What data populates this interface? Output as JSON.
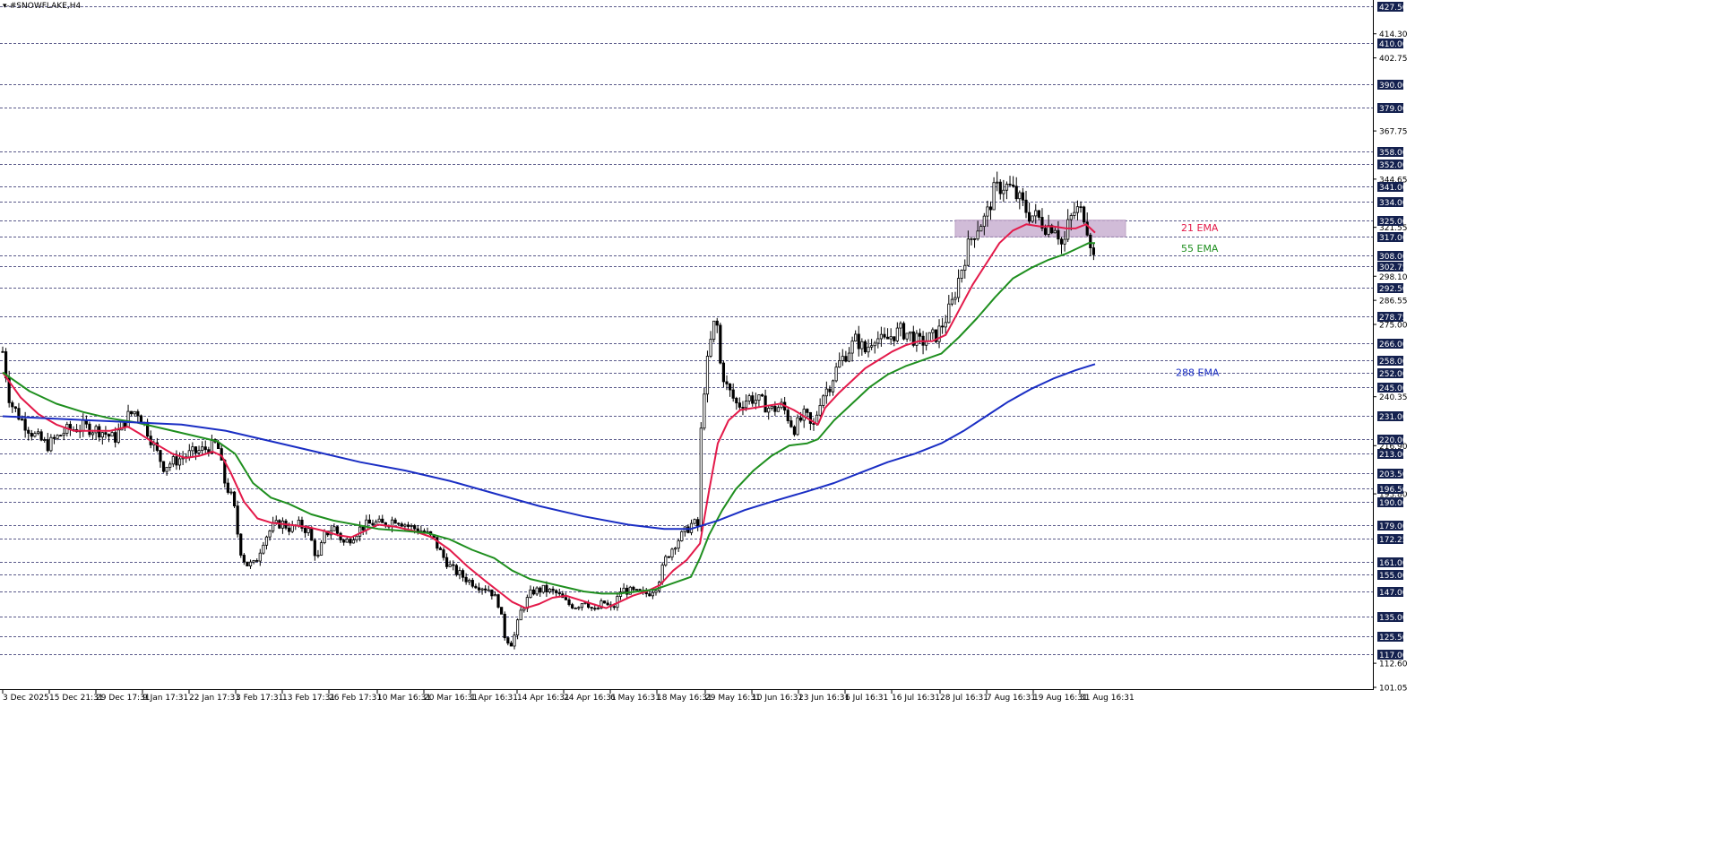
{
  "title": "▾-#SNOWFLAKE,H4",
  "colors": {
    "ema21": "#e31a4a",
    "ema55": "#1f8f1f",
    "ema288": "#1a2ec4",
    "zone": "#cdb5d4",
    "tag": "#14214f",
    "grid": "#5a5a8a"
  },
  "chart_data": {
    "type": "candlestick",
    "symbol": "#SNOWFLAKE",
    "timeframe": "H4",
    "ylim": [
      101.05,
      427.5
    ],
    "y_ticks": [
      "414.30",
      "402.75",
      "367.75",
      "344.65",
      "321.55",
      "298.10",
      "286.55",
      "275.00",
      "240.35",
      "216.90",
      "193.80",
      "112.60",
      "101.05"
    ],
    "x_ticks": [
      "3 Dec 2025",
      "15 Dec 21:31",
      "29 Dec 17:31",
      "9 Jan 17:31",
      "22 Jan 17:31",
      "3 Feb 17:31",
      "13 Feb 17:31",
      "26 Feb 17:31",
      "10 Mar 16:31",
      "20 Mar 16:31",
      "1 Apr 16:31",
      "14 Apr 16:31",
      "24 Apr 16:31",
      "6 May 16:31",
      "18 May 16:31",
      "29 May 16:31",
      "10 Jun 16:31",
      "23 Jun 16:31",
      "6 Jul 16:31",
      "16 Jul 16:31",
      "28 Jul 16:31",
      "7 Aug 16:31",
      "19 Aug 16:31",
      "31 Aug 16:31"
    ],
    "levels": [
      "427.50",
      "410.00",
      "390.00",
      "379.00",
      "358.00",
      "352.00",
      "341.00",
      "334.00",
      "325.00",
      "317.00",
      "308.00",
      "302.75",
      "292.50",
      "278.75",
      "266.00",
      "258.00",
      "252.00",
      "245.00",
      "231.00",
      "220.00",
      "213.00",
      "203.50",
      "196.50",
      "190.00",
      "179.00",
      "172.25",
      "161.00",
      "155.00",
      "147.00",
      "135.00",
      "125.50",
      "117.00"
    ],
    "zone": {
      "low": 317.0,
      "high": 325.0
    },
    "series": [
      {
        "name": "21 EMA",
        "key": "ema21",
        "points": [
          [
            0,
            252
          ],
          [
            20,
            240
          ],
          [
            40,
            232
          ],
          [
            60,
            227
          ],
          [
            80,
            224
          ],
          [
            100,
            224
          ],
          [
            120,
            224
          ],
          [
            140,
            226
          ],
          [
            152,
            223
          ],
          [
            170,
            218
          ],
          [
            190,
            213
          ],
          [
            205,
            211
          ],
          [
            220,
            212
          ],
          [
            235,
            214
          ],
          [
            245,
            212
          ],
          [
            255,
            204
          ],
          [
            270,
            190
          ],
          [
            285,
            182
          ],
          [
            300,
            180
          ],
          [
            320,
            179
          ],
          [
            340,
            178
          ],
          [
            360,
            176
          ],
          [
            375,
            174
          ],
          [
            390,
            173
          ],
          [
            405,
            176
          ],
          [
            420,
            179
          ],
          [
            440,
            178
          ],
          [
            460,
            176
          ],
          [
            480,
            173
          ],
          [
            500,
            167
          ],
          [
            520,
            159
          ],
          [
            540,
            152
          ],
          [
            555,
            147
          ],
          [
            570,
            142
          ],
          [
            585,
            139
          ],
          [
            600,
            141
          ],
          [
            615,
            144
          ],
          [
            630,
            145
          ],
          [
            645,
            143
          ],
          [
            660,
            141
          ],
          [
            675,
            139
          ],
          [
            690,
            142
          ],
          [
            705,
            145
          ],
          [
            720,
            147
          ],
          [
            735,
            150
          ],
          [
            750,
            157
          ],
          [
            765,
            162
          ],
          [
            780,
            170
          ],
          [
            790,
            195
          ],
          [
            800,
            218
          ],
          [
            812,
            229
          ],
          [
            825,
            234
          ],
          [
            840,
            235
          ],
          [
            855,
            236
          ],
          [
            870,
            237
          ],
          [
            885,
            234
          ],
          [
            900,
            230
          ],
          [
            912,
            227
          ],
          [
            920,
            235
          ],
          [
            935,
            242
          ],
          [
            950,
            248
          ],
          [
            965,
            254
          ],
          [
            980,
            258
          ],
          [
            995,
            262
          ],
          [
            1010,
            265
          ],
          [
            1025,
            267
          ],
          [
            1040,
            267
          ],
          [
            1055,
            270
          ],
          [
            1070,
            282
          ],
          [
            1085,
            294
          ],
          [
            1100,
            304
          ],
          [
            1115,
            314
          ],
          [
            1130,
            320
          ],
          [
            1145,
            323
          ],
          [
            1160,
            322
          ],
          [
            1175,
            322
          ],
          [
            1190,
            321
          ],
          [
            1200,
            321
          ],
          [
            1212,
            323
          ],
          [
            1222,
            319
          ]
        ]
      },
      {
        "name": "55 EMA",
        "key": "ema55",
        "points": [
          [
            0,
            252
          ],
          [
            30,
            243
          ],
          [
            60,
            237
          ],
          [
            90,
            233
          ],
          [
            120,
            230
          ],
          [
            150,
            228
          ],
          [
            180,
            225
          ],
          [
            210,
            222
          ],
          [
            240,
            219
          ],
          [
            260,
            213
          ],
          [
            280,
            199
          ],
          [
            300,
            192
          ],
          [
            320,
            189
          ],
          [
            345,
            184
          ],
          [
            370,
            181
          ],
          [
            395,
            179
          ],
          [
            420,
            177
          ],
          [
            450,
            176
          ],
          [
            475,
            175
          ],
          [
            500,
            172
          ],
          [
            525,
            167
          ],
          [
            550,
            163
          ],
          [
            570,
            157
          ],
          [
            590,
            153
          ],
          [
            610,
            151
          ],
          [
            630,
            149
          ],
          [
            650,
            147
          ],
          [
            670,
            146
          ],
          [
            690,
            146
          ],
          [
            710,
            147
          ],
          [
            730,
            148
          ],
          [
            750,
            151
          ],
          [
            770,
            154
          ],
          [
            780,
            163
          ],
          [
            790,
            174
          ],
          [
            805,
            186
          ],
          [
            820,
            196
          ],
          [
            840,
            205
          ],
          [
            860,
            212
          ],
          [
            880,
            217
          ],
          [
            900,
            218
          ],
          [
            912,
            220
          ],
          [
            930,
            229
          ],
          [
            950,
            237
          ],
          [
            970,
            245
          ],
          [
            990,
            251
          ],
          [
            1010,
            255
          ],
          [
            1030,
            258
          ],
          [
            1050,
            261
          ],
          [
            1070,
            269
          ],
          [
            1090,
            278
          ],
          [
            1110,
            288
          ],
          [
            1130,
            297
          ],
          [
            1150,
            302
          ],
          [
            1170,
            306
          ],
          [
            1190,
            309
          ],
          [
            1205,
            312
          ],
          [
            1215,
            314
          ],
          [
            1222,
            314
          ]
        ]
      },
      {
        "name": "288 EMA",
        "key": "ema288",
        "points": [
          [
            0,
            231
          ],
          [
            100,
            229
          ],
          [
            200,
            227
          ],
          [
            250,
            224
          ],
          [
            300,
            219
          ],
          [
            350,
            214
          ],
          [
            400,
            209
          ],
          [
            450,
            205
          ],
          [
            500,
            200
          ],
          [
            550,
            194
          ],
          [
            600,
            188
          ],
          [
            650,
            183
          ],
          [
            700,
            179
          ],
          [
            740,
            177
          ],
          [
            770,
            177
          ],
          [
            800,
            181
          ],
          [
            830,
            186
          ],
          [
            860,
            190
          ],
          [
            900,
            195
          ],
          [
            930,
            199
          ],
          [
            960,
            204
          ],
          [
            990,
            209
          ],
          [
            1020,
            213
          ],
          [
            1050,
            218
          ],
          [
            1075,
            224
          ],
          [
            1100,
            231
          ],
          [
            1125,
            238
          ],
          [
            1150,
            244
          ],
          [
            1175,
            249
          ],
          [
            1200,
            253
          ],
          [
            1222,
            256
          ]
        ]
      }
    ],
    "candle_anchors": [
      [
        0,
        262
      ],
      [
        8,
        238
      ],
      [
        20,
        230
      ],
      [
        35,
        222
      ],
      [
        50,
        217
      ],
      [
        70,
        224
      ],
      [
        90,
        226
      ],
      [
        110,
        224
      ],
      [
        125,
        220
      ],
      [
        140,
        231
      ],
      [
        150,
        234
      ],
      [
        160,
        226
      ],
      [
        172,
        214
      ],
      [
        180,
        207
      ],
      [
        195,
        210
      ],
      [
        210,
        213
      ],
      [
        225,
        215
      ],
      [
        240,
        218
      ],
      [
        248,
        200
      ],
      [
        258,
        190
      ],
      [
        265,
        168
      ],
      [
        272,
        160
      ],
      [
        282,
        160
      ],
      [
        292,
        172
      ],
      [
        302,
        178
      ],
      [
        312,
        180
      ],
      [
        322,
        177
      ],
      [
        332,
        179
      ],
      [
        342,
        176
      ],
      [
        352,
        162
      ],
      [
        360,
        174
      ],
      [
        370,
        178
      ],
      [
        382,
        170
      ],
      [
        392,
        174
      ],
      [
        402,
        178
      ],
      [
        415,
        180
      ],
      [
        425,
        179
      ],
      [
        440,
        182
      ],
      [
        455,
        178
      ],
      [
        470,
        176
      ],
      [
        482,
        172
      ],
      [
        492,
        164
      ],
      [
        502,
        158
      ],
      [
        512,
        155
      ],
      [
        522,
        152
      ],
      [
        532,
        150
      ],
      [
        545,
        148
      ],
      [
        555,
        141
      ],
      [
        562,
        125
      ],
      [
        570,
        122
      ],
      [
        580,
        138
      ],
      [
        592,
        147
      ],
      [
        605,
        148
      ],
      [
        620,
        146
      ],
      [
        632,
        141
      ],
      [
        642,
        140
      ],
      [
        652,
        143
      ],
      [
        662,
        137
      ],
      [
        672,
        142
      ],
      [
        682,
        138
      ],
      [
        692,
        148
      ],
      [
        702,
        147
      ],
      [
        712,
        146
      ],
      [
        722,
        146
      ],
      [
        732,
        150
      ],
      [
        742,
        163
      ],
      [
        752,
        170
      ],
      [
        762,
        175
      ],
      [
        772,
        180
      ],
      [
        778,
        178
      ],
      [
        782,
        235
      ],
      [
        790,
        262
      ],
      [
        798,
        280
      ],
      [
        803,
        255
      ],
      [
        810,
        245
      ],
      [
        822,
        236
      ],
      [
        835,
        240
      ],
      [
        848,
        238
      ],
      [
        860,
        234
      ],
      [
        872,
        236
      ],
      [
        885,
        225
      ],
      [
        898,
        232
      ],
      [
        906,
        224
      ],
      [
        915,
        240
      ],
      [
        925,
        246
      ],
      [
        935,
        256
      ],
      [
        945,
        262
      ],
      [
        955,
        268
      ],
      [
        965,
        262
      ],
      [
        975,
        270
      ],
      [
        985,
        266
      ],
      [
        995,
        270
      ],
      [
        1005,
        272
      ],
      [
        1015,
        270
      ],
      [
        1025,
        266
      ],
      [
        1035,
        268
      ],
      [
        1045,
        270
      ],
      [
        1055,
        278
      ],
      [
        1062,
        285
      ],
      [
        1070,
        298
      ],
      [
        1078,
        310
      ],
      [
        1085,
        318
      ],
      [
        1092,
        323
      ],
      [
        1100,
        326
      ],
      [
        1108,
        338
      ],
      [
        1118,
        342
      ],
      [
        1128,
        340
      ],
      [
        1138,
        334
      ],
      [
        1148,
        328
      ],
      [
        1158,
        326
      ],
      [
        1168,
        322
      ],
      [
        1178,
        323
      ],
      [
        1186,
        311
      ],
      [
        1192,
        323
      ],
      [
        1200,
        330
      ],
      [
        1210,
        328
      ],
      [
        1218,
        313
      ],
      [
        1222,
        303
      ]
    ]
  },
  "ema_labels": {
    "ema21": "21 EMA",
    "ema55": "55 EMA",
    "ema288": "288 EMA"
  }
}
